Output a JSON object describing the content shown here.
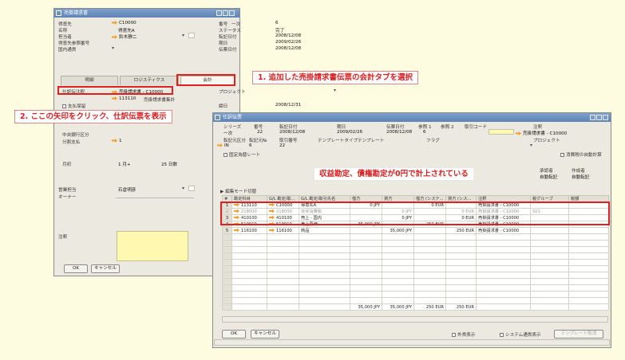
{
  "left_window": {
    "title": "売掛請求書",
    "fields": [
      {
        "label": "得意先",
        "value": "C10000"
      },
      {
        "label": "名称",
        "value": "得意先A"
      },
      {
        "label": "担当者",
        "value": "鈴木静二"
      },
      {
        "label": "得意先参照番号",
        "value": ""
      },
      {
        "label": "国内通貨",
        "value": ""
      }
    ],
    "right_fields": [
      {
        "label": "番号",
        "sub": "一次",
        "value": "6"
      },
      {
        "label": "ステータス",
        "sub": "",
        "value": "完了"
      },
      {
        "label": "転記日付",
        "sub": "",
        "value": "2008/12/08"
      },
      {
        "label": "期日",
        "sub": "",
        "value": "2009/02/26"
      },
      {
        "label": "伝票日付",
        "sub": "",
        "value": "2008/12/08"
      }
    ],
    "tabs": [
      "明細",
      "ロジスティクス",
      "会計"
    ],
    "journal_label": "仕訳伝注釈",
    "journal_value": "売掛請求書 - C10000",
    "journal_sub_value": "113110",
    "journal_sub_label": "売掛請求書集計",
    "project_label": "プロジェクト",
    "date_label": "締日",
    "date_value": "2008/12/31",
    "chk_label": "支払保留",
    "bank_label": "中央銀行区分",
    "sort_label": "分割支払",
    "sort_value": "1",
    "due_label": "月初",
    "due_month": "1 月+",
    "due_days": "25 日数",
    "sales_label": "営業担当",
    "sales_value": "石倉明彦",
    "owner_label": "オーナー",
    "remark_label": "注釈",
    "ok_label": "OK",
    "cancel_label": "キャンセル"
  },
  "callouts": {
    "one": "1. 追加した売掛請求書伝票の会計タブを選択",
    "two": "2. ここの矢印をクリック、仕訳伝票を表示",
    "three": "収益勘定、債権勘定が0円で計上されている"
  },
  "journal_window": {
    "title": "仕訳伝票",
    "header_labels": [
      "シリーズ",
      "番号",
      "転記日付",
      "期日",
      "伝票日付",
      "参照 1",
      "参照 2",
      "取引コード",
      "注釈"
    ],
    "header_values": [
      "一次",
      "22",
      "2008/12/08",
      "2009/02/26",
      "2008/12/08",
      "6",
      "",
      "",
      "売掛請求書 - C10000"
    ],
    "row2_labels": [
      "転記元区分",
      "転記元№",
      "取引番号",
      "テンプレートタイプ",
      "テンプレート",
      "フラグ",
      "プロジェクト"
    ],
    "row2_values": [
      "IN",
      "6",
      "22"
    ],
    "fixed_rate_label": "固定為替レート",
    "auto_label": "消費税の自動計算",
    "approver_label": "承認者",
    "approver_value": "自動転記",
    "author_label": "作成者",
    "author_value": "自動転記",
    "edit_label": "編集モード切替",
    "columns": [
      "#",
      "勘定科目",
      "G/L 勘定/取...",
      "G/L 勘定/取引先名",
      "借方",
      "貸方",
      "借方 (システ...",
      "貸方 (シス...",
      "注釈",
      "税グループ",
      "税額"
    ],
    "rows": [
      {
        "n": "1",
        "acct": "113110",
        "code": "C10000",
        "name": "得意先A",
        "debit": "0 JPY",
        "credit": "",
        "dsys": "0 EUR",
        "csys": "",
        "remark": "売掛請求書 - C10000",
        "tax": "",
        "gray": false
      },
      {
        "n": "2",
        "acct": "218000",
        "code": "218000",
        "name": "仮受消費税",
        "debit": "",
        "credit": "0 JPY",
        "dsys": "",
        "csys": "0 EUR",
        "remark": "売掛請求書 - C10000",
        "tax": "S01",
        "gray": true
      },
      {
        "n": "3",
        "acct": "410100",
        "code": "410100",
        "name": "売上 - 国内",
        "debit": "",
        "credit": "0 JPY",
        "dsys": "",
        "csys": "0 EUR",
        "remark": "売掛請求書 - C10000",
        "tax": "",
        "gray": false
      },
      {
        "n": "4",
        "acct": "510010",
        "code": "510010",
        "name": "売上原価",
        "debit": "35,000 JPY",
        "credit": "",
        "dsys": "250 EUR",
        "csys": "",
        "remark": "売掛請求書 - C10000",
        "tax": "",
        "gray": false
      },
      {
        "n": "5",
        "acct": "116100",
        "code": "116100",
        "name": "商品",
        "debit": "",
        "credit": "35,000 JPY",
        "dsys": "",
        "csys": "250 EUR",
        "remark": "売掛請求書 - C10000",
        "tax": "",
        "gray": false
      }
    ],
    "totals": [
      "35,000 JPY",
      "35,000 JPY",
      "250 EUR",
      "250 EUR"
    ],
    "ok_label": "OK",
    "cancel_label": "キャンセル",
    "foreign_label": "外貨表示",
    "system_label": "システム通貨表示",
    "template_btn": "テンプレート取消"
  },
  "colors": {
    "callout_red": "#d81e1e",
    "titlebar": "#6a8fc0",
    "highlight_yellow": "#fff8b0"
  }
}
